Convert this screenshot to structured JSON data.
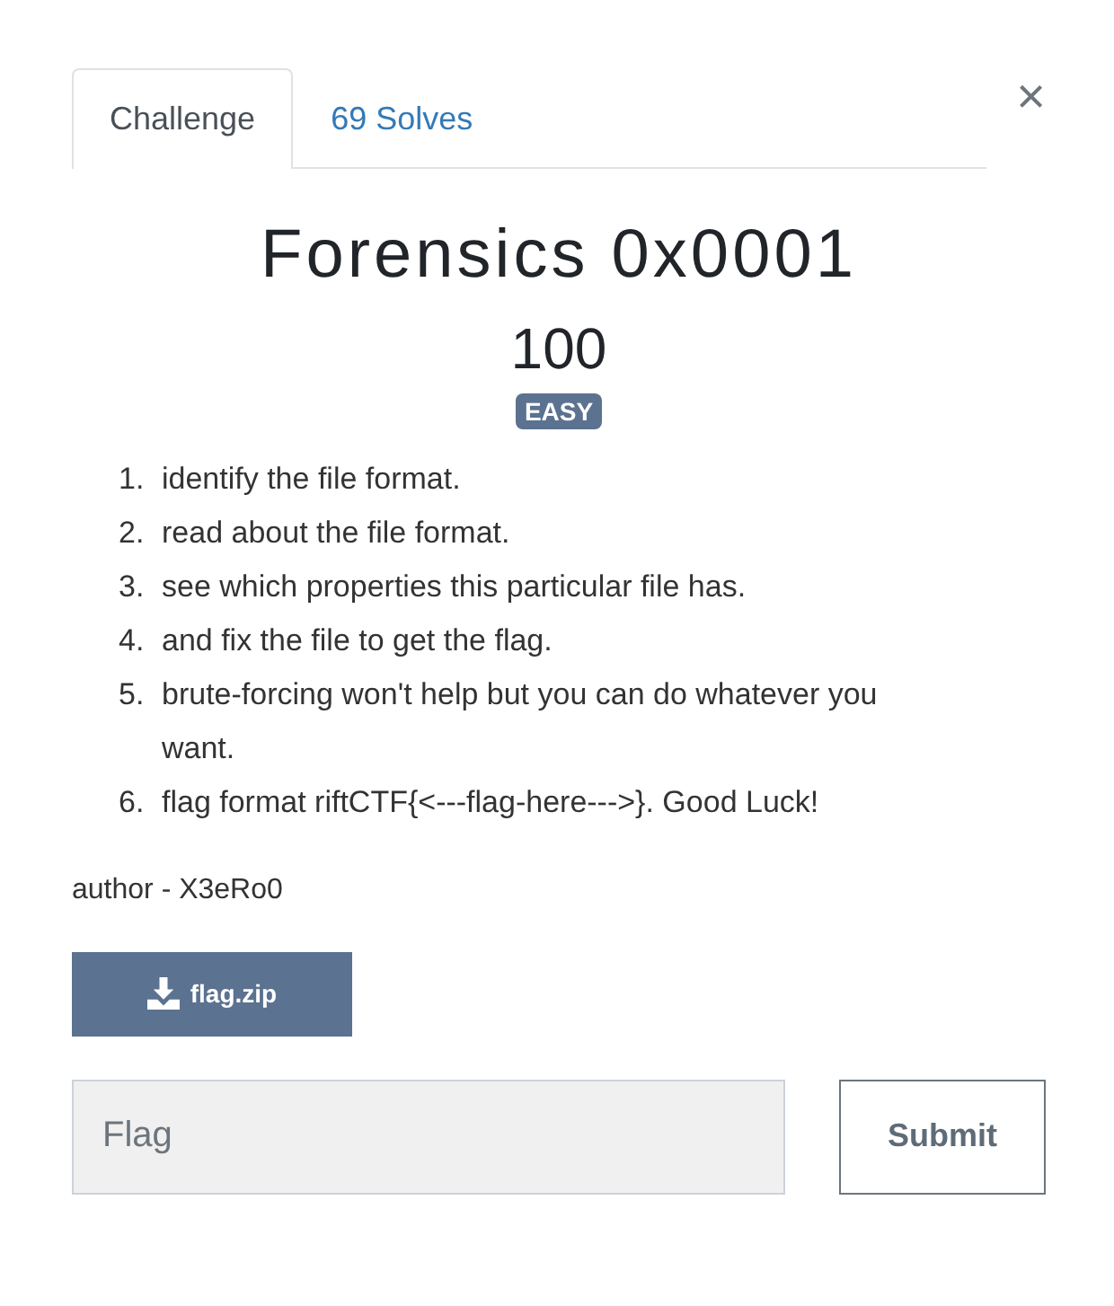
{
  "tabs": [
    {
      "label": "Challenge",
      "selected": true
    },
    {
      "label": "69 Solves",
      "selected": false
    }
  ],
  "close": "×",
  "title": "Forensics 0x0001",
  "points": "100",
  "difficulty": "EASY",
  "steps": [
    {
      "number": "1.",
      "text": "identify the file format."
    },
    {
      "number": "2.",
      "text": "read about the file format."
    },
    {
      "number": "3.",
      "text": "see which properties this particular file has."
    },
    {
      "number": "4.",
      "text": "and fix the file to get the flag."
    },
    {
      "number": "5.",
      "text": "brute-forcing won't help but you can do whatever you want."
    },
    {
      "number": "6.",
      "text": "flag format riftCTF{<---flag-here--->}. Good Luck!"
    }
  ],
  "author": "author - X3eRo0",
  "file": {
    "label": "flag.zip"
  },
  "flag_field": {
    "placeholder": "Flag"
  },
  "submit": "Submit"
}
